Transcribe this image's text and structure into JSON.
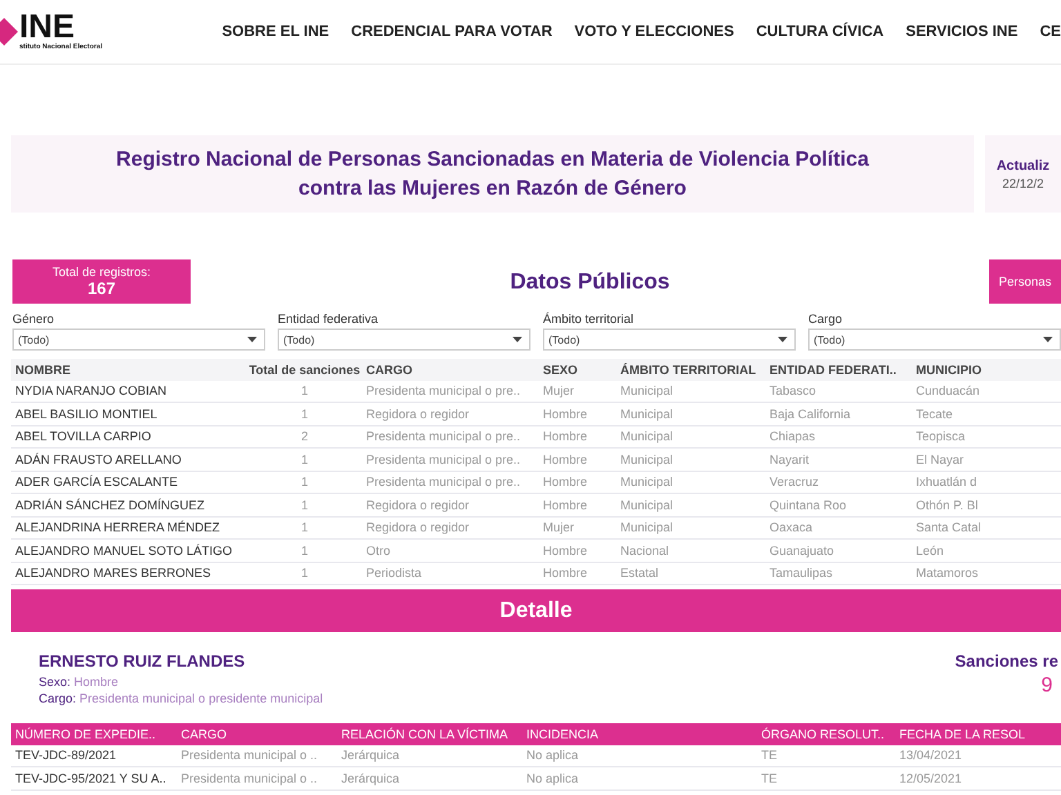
{
  "header": {
    "logo": {
      "name": "INE",
      "subtitle": "stituto Nacional Electoral"
    },
    "nav": [
      "SOBRE EL INE",
      "CREDENCIAL PARA VOTAR",
      "VOTO Y ELECCIONES",
      "CULTURA CÍVICA",
      "SERVICIOS INE",
      "CE"
    ]
  },
  "title_band": {
    "title": "Registro Nacional de Personas Sancionadas en Materia de Violencia Política contra las Mujeres en Razón de Género",
    "update_label": "Actualiz",
    "update_date": "22/12/2"
  },
  "total": {
    "label": "Total de registros:",
    "value": "167"
  },
  "section_title": "Datos Públicos",
  "personas_label": "Personas",
  "filters": [
    {
      "label": "Género",
      "value": "(Todo)"
    },
    {
      "label": "Entidad federativa",
      "value": "(Todo)"
    },
    {
      "label": "Ámbito territorial",
      "value": "(Todo)"
    },
    {
      "label": "Cargo",
      "value": "(Todo)"
    }
  ],
  "table": {
    "columns": [
      "NOMBRE",
      "Total de sanciones",
      "CARGO",
      "SEXO",
      "ÁMBITO TERRITORIAL",
      "ENTIDAD FEDERATI..",
      "MUNICIPIO"
    ],
    "rows": [
      [
        "NYDIA NARANJO COBIAN",
        "1",
        "Presidenta municipal o pre..",
        "Mujer",
        "Municipal",
        "Tabasco",
        "Cunduacán"
      ],
      [
        "ABEL BASILIO MONTIEL",
        "1",
        "Regidora o regidor",
        "Hombre",
        "Municipal",
        "Baja California",
        "Tecate"
      ],
      [
        "ABEL TOVILLA CARPIO",
        "2",
        "Presidenta municipal o pre..",
        "Hombre",
        "Municipal",
        "Chiapas",
        "Teopisca"
      ],
      [
        "ADÁN FRAUSTO ARELLANO",
        "1",
        "Presidenta municipal o pre..",
        "Hombre",
        "Municipal",
        "Nayarit",
        "El Nayar"
      ],
      [
        "ADER GARCÍA ESCALANTE",
        "1",
        "Presidenta municipal o pre..",
        "Hombre",
        "Municipal",
        "Veracruz",
        "Ixhuatlán d"
      ],
      [
        "ADRIÁN SÁNCHEZ DOMÍNGUEZ",
        "1",
        "Regidora o regidor",
        "Hombre",
        "Municipal",
        "Quintana Roo",
        "Othón P. Bl"
      ],
      [
        "ALEJANDRINA HERRERA MÉNDEZ",
        "1",
        "Regidora o regidor",
        "Mujer",
        "Municipal",
        "Oaxaca",
        "Santa Catal"
      ],
      [
        "ALEJANDRO MANUEL SOTO LÁTIGO",
        "1",
        "Otro",
        "Hombre",
        "Nacional",
        "Guanajuato",
        "León"
      ],
      [
        "ALEJANDRO MARES BERRONES",
        "1",
        "Periodista",
        "Hombre",
        "Estatal",
        "Tamaulipas",
        "Matamoros"
      ]
    ]
  },
  "detail": {
    "title": "Detalle",
    "name": "ERNESTO RUIZ FLANDES",
    "fields": [
      {
        "label": "Sexo:",
        "value": "Hombre"
      },
      {
        "label": "Cargo:",
        "value": "Presidenta municipal o presidente municipal"
      }
    ],
    "sanctions_label": "Sanciones re",
    "sanctions_value": "9",
    "table": {
      "columns": [
        "NÚMERO DE EXPEDIE..",
        "CARGO",
        "RELACIÓN CON LA VÍCTIMA",
        "INCIDENCIA",
        "ÓRGANO RESOLUT..",
        "FECHA DE LA RESOL"
      ],
      "rows": [
        [
          "TEV-JDC-89/2021",
          "Presidenta municipal o ..",
          "Jerárquica",
          "No aplica",
          "TE",
          "13/04/2021"
        ],
        [
          "TEV-JDC-95/2021 Y SU A..",
          "Presidenta municipal o ..",
          "Jerárquica",
          "No aplica",
          "TE",
          "12/05/2021"
        ]
      ]
    }
  }
}
